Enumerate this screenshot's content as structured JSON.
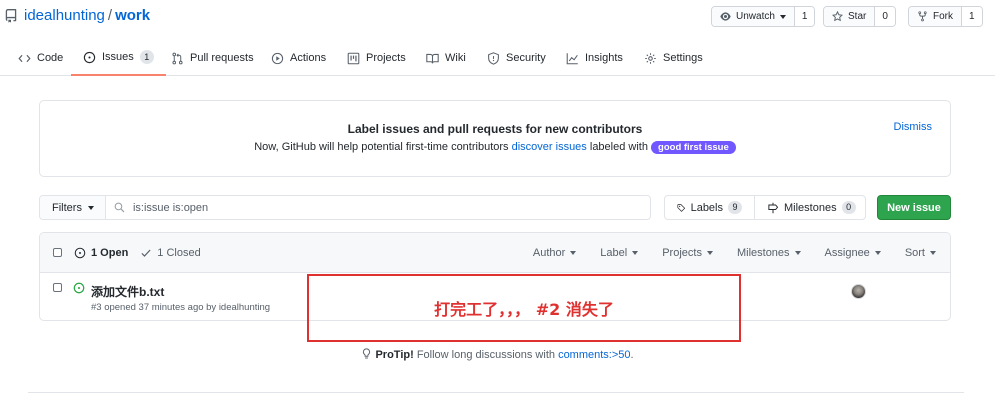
{
  "repo": {
    "owner": "idealhunting",
    "separator": "/",
    "name": "work"
  },
  "actions": {
    "watch": {
      "label": "Unwatch",
      "count": "1"
    },
    "star": {
      "label": "Star",
      "count": "0"
    },
    "fork": {
      "label": "Fork",
      "count": "1"
    }
  },
  "tabs": [
    {
      "label": "Code",
      "icon": "code-icon"
    },
    {
      "label": "Issues",
      "icon": "issue-opened-icon",
      "count": "1",
      "active": true
    },
    {
      "label": "Pull requests",
      "icon": "git-pull-request-icon"
    },
    {
      "label": "Actions",
      "icon": "play-icon"
    },
    {
      "label": "Projects",
      "icon": "project-icon"
    },
    {
      "label": "Wiki",
      "icon": "book-icon"
    },
    {
      "label": "Security",
      "icon": "shield-icon"
    },
    {
      "label": "Insights",
      "icon": "graph-icon"
    },
    {
      "label": "Settings",
      "icon": "gear-icon"
    }
  ],
  "banner": {
    "title": "Label issues and pull requests for new contributors",
    "text_before": "Now, GitHub will help potential first-time contributors ",
    "link": "discover issues",
    "text_after": " labeled with ",
    "label": "good first issue",
    "dismiss": "Dismiss"
  },
  "filters": {
    "button": "Filters",
    "query": "is:issue is:open"
  },
  "labels": {
    "label": "Labels",
    "count": "9"
  },
  "milestones": {
    "label": "Milestones",
    "count": "0"
  },
  "new_issue": "New issue",
  "list_header": {
    "open": "1 Open",
    "closed": "1 Closed",
    "sort_options": [
      "Author",
      "Label",
      "Projects",
      "Milestones",
      "Assignee",
      "Sort"
    ]
  },
  "issues": [
    {
      "title": "添加文件b.txt",
      "meta": "#3 opened 37 minutes ago by idealhunting"
    }
  ],
  "annotation": "打完工了，，，  #2 消失了",
  "protip": {
    "prefix": "ProTip!",
    "text": " Follow long discussions with ",
    "link": "comments:>50",
    "suffix": "."
  },
  "colors": {
    "accent": "#0366d6",
    "tab_active": "#f9826c",
    "primary_button": "#2ea44f",
    "label_purple": "#7057ff",
    "annotation_red": "#e03131"
  }
}
